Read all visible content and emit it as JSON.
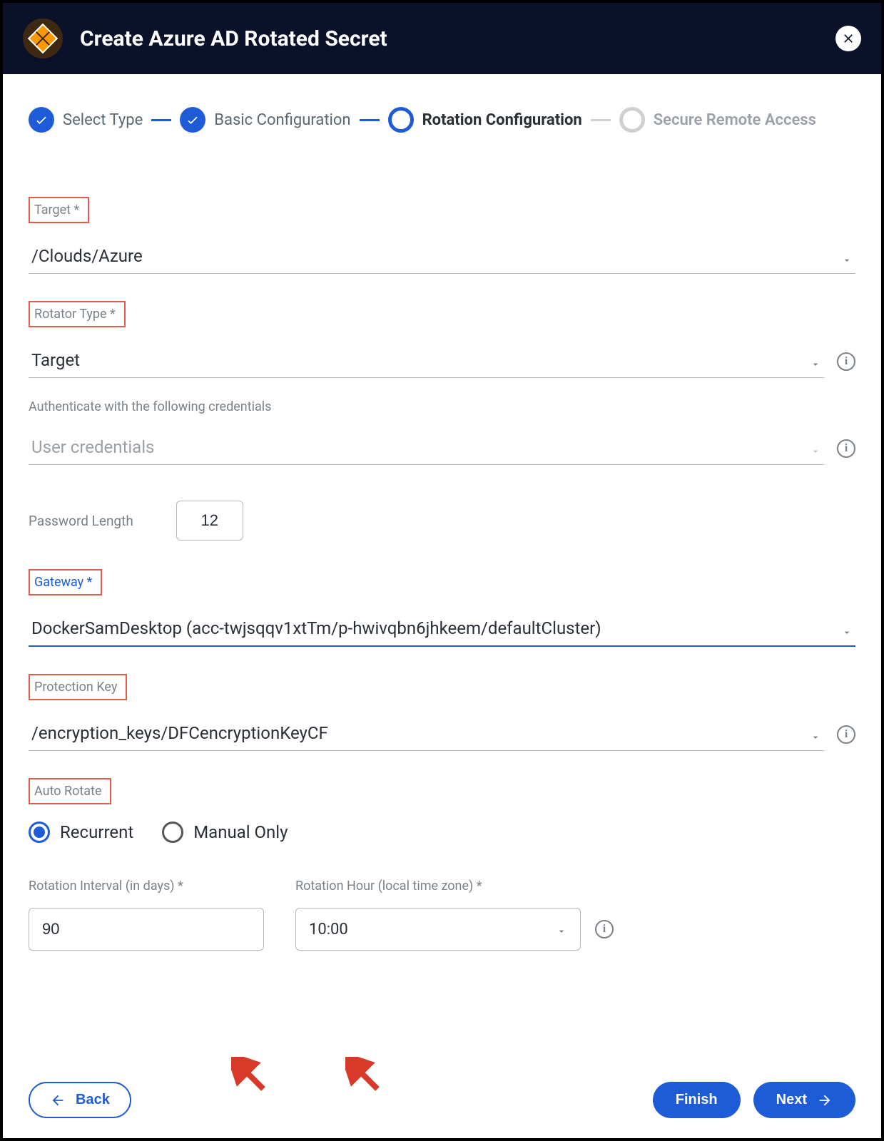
{
  "header": {
    "title": "Create Azure AD Rotated Secret"
  },
  "stepper": {
    "step1": "Select Type",
    "step2": "Basic Configuration",
    "step3": "Rotation Configuration",
    "step4": "Secure Remote Access"
  },
  "fields": {
    "target_label": "Target *",
    "target_value": "/Clouds/Azure",
    "rotator_type_label": "Rotator Type *",
    "rotator_type_value": "Target",
    "auth_label": "Authenticate with the following credentials",
    "auth_value": "User credentials",
    "password_length_label": "Password Length",
    "password_length_value": "12",
    "gateway_label": "Gateway *",
    "gateway_value": "DockerSamDesktop (acc-twjsqqv1xtTm/p-hwivqbn6jhkeem/defaultCluster)",
    "protection_key_label": "Protection Key",
    "protection_key_value": "/encryption_keys/DFCencryptionKeyCF",
    "auto_rotate_label": "Auto Rotate",
    "radio_recurrent": "Recurrent",
    "radio_manual": "Manual Only",
    "rotation_interval_label": "Rotation Interval (in days) *",
    "rotation_interval_value": "90",
    "rotation_hour_label": "Rotation Hour (local time zone) *",
    "rotation_hour_value": "10:00"
  },
  "buttons": {
    "back": "Back",
    "finish": "Finish",
    "next": "Next"
  },
  "colors": {
    "primary": "#1e5bd6",
    "header_bg": "#0a1128",
    "highlight_border": "#e25a4a",
    "arrow": "#d83a2a"
  }
}
